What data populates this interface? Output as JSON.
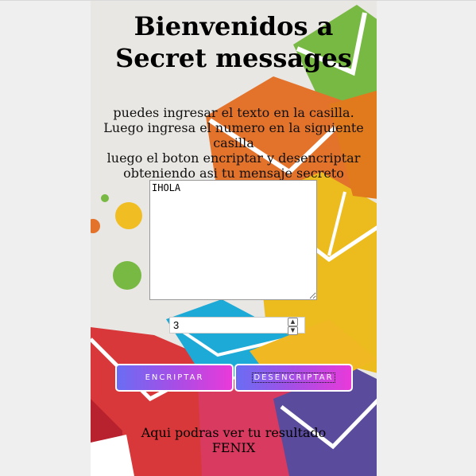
{
  "page": {
    "title": "Bienvenidos a Secret messages",
    "instructions": [
      "puedes ingresar el texto en la casilla.",
      "Luego ingresa el numero en la siguiente casilla",
      "luego el boton encriptar y desencriptar",
      "obteniendo asi tu mensaje secreto"
    ]
  },
  "form": {
    "message_value": "IHOLA",
    "number_value": "3",
    "encrypt_label": "ENCRIPTAR",
    "decrypt_label": "DESENCRIPTAR"
  },
  "result": {
    "label": "Aqui podras ver tu resultado",
    "value": "FENIX"
  },
  "theme": {
    "page_background": "#efefef",
    "button_gradient": [
      "#6a6df3",
      "#e93ad9"
    ]
  }
}
